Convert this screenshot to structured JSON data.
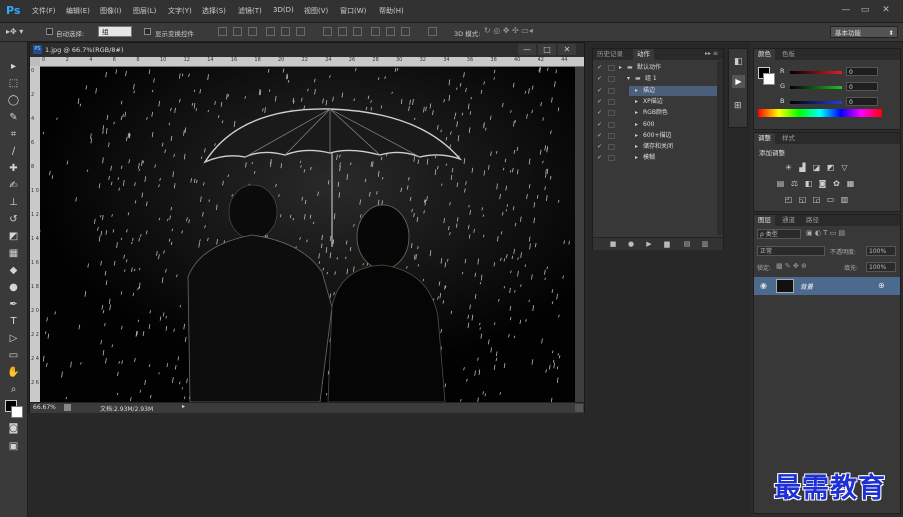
{
  "app": {
    "logo": "Ps",
    "menu": [
      "文件(F)",
      "编辑(E)",
      "图像(I)",
      "图层(L)",
      "文字(Y)",
      "选择(S)",
      "滤镜(T)",
      "3D(D)",
      "视图(V)",
      "窗口(W)",
      "帮助(H)"
    ],
    "window_controls": [
      "—",
      "▭",
      "✕"
    ]
  },
  "options_bar": {
    "auto_select_label": "自动选择:",
    "auto_select_value": "组",
    "show_transform_label": "显示变换控件",
    "mode_3d_label": "3D 模式:",
    "workspace": "基本功能"
  },
  "document": {
    "title": "1.jpg @ 66.7%(RGB/8#)",
    "icon_text": "PS",
    "ruler_top": [
      "0",
      "2",
      "4",
      "6",
      "8",
      "10",
      "12",
      "14",
      "16",
      "18",
      "20",
      "22",
      "24",
      "26",
      "28",
      "30",
      "32",
      "34",
      "36",
      "38",
      "40",
      "42",
      "44"
    ],
    "ruler_left": [
      "0",
      "2",
      "4",
      "6",
      "8",
      "1 0",
      "1 2",
      "1 4",
      "1 6",
      "1 8",
      "2 0",
      "2 2",
      "2 4",
      "2 6"
    ],
    "zoom": "66.67%",
    "doc_size": "文档:2.93M/2.93M",
    "buttons": [
      "—",
      "□",
      "✕"
    ]
  },
  "actions_panel": {
    "tabs": [
      "历史记录",
      "动作"
    ],
    "rows": [
      {
        "indent": 0,
        "label": "默认动作",
        "type": "set",
        "expanded": false
      },
      {
        "indent": 1,
        "label": "组 1",
        "type": "set",
        "expanded": true
      },
      {
        "indent": 2,
        "label": "描边",
        "type": "action",
        "expanded": false,
        "selected": true
      },
      {
        "indent": 2,
        "label": "XP描边",
        "type": "action",
        "expanded": false
      },
      {
        "indent": 2,
        "label": "RGB颜色",
        "type": "action",
        "expanded": false
      },
      {
        "indent": 2,
        "label": "600",
        "type": "action",
        "expanded": false
      },
      {
        "indent": 2,
        "label": "600+描边",
        "type": "action",
        "expanded": false
      },
      {
        "indent": 2,
        "label": "储存和关闭",
        "type": "action",
        "expanded": false
      },
      {
        "indent": 2,
        "label": "模糊",
        "type": "action",
        "expanded": false
      }
    ],
    "footer_icons": [
      "stop-icon",
      "record-icon",
      "play-icon",
      "new-set-icon",
      "new-action-icon",
      "delete-icon"
    ]
  },
  "color_panel": {
    "tabs": [
      "颜色",
      "色板"
    ],
    "channels": [
      {
        "label": "R",
        "value": "0",
        "color": "#e02020"
      },
      {
        "label": "G",
        "value": "0",
        "color": "#20c020"
      },
      {
        "label": "B",
        "value": "0",
        "color": "#2040e0"
      }
    ]
  },
  "adjustments_panel": {
    "tabs": [
      "调整",
      "样式"
    ],
    "title": "添加调整"
  },
  "layers_panel": {
    "tabs": [
      "图层",
      "通道",
      "路径"
    ],
    "kind_label": "ρ 类型",
    "blend_mode": "正常",
    "opacity_label": "不透明度:",
    "opacity_value": "100%",
    "lock_label": "锁定:",
    "fill_label": "填充:",
    "fill_value": "100%",
    "layer_name": "背景"
  },
  "watermark": "最需教育"
}
